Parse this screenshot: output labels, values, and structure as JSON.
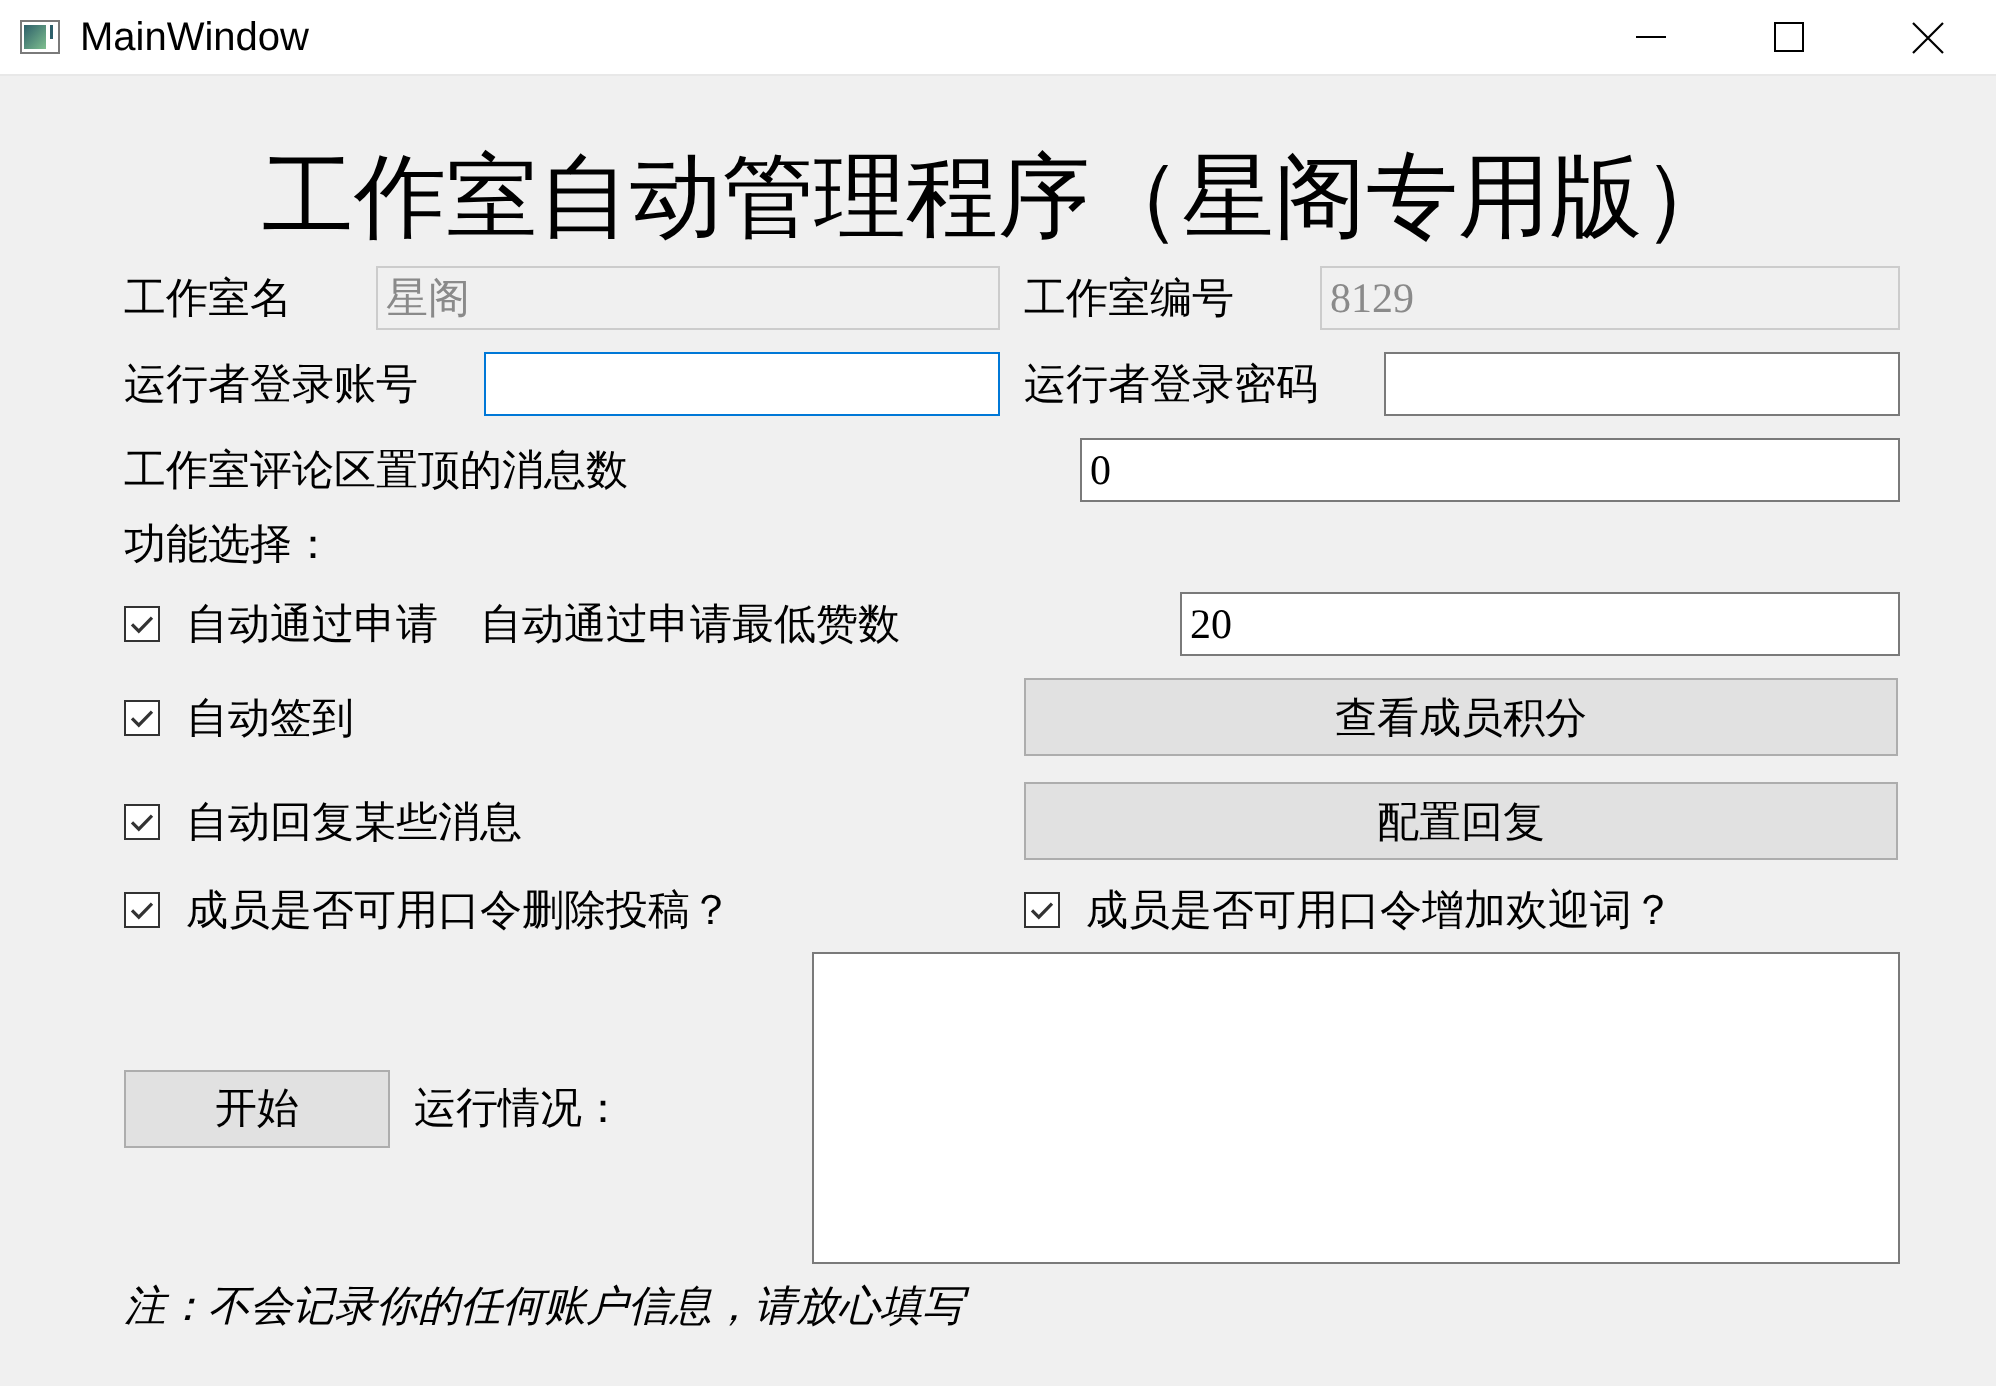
{
  "window": {
    "title": "MainWindow"
  },
  "heading": "工作室自动管理程序（星阁专用版）",
  "studio_name": {
    "label": "工作室名",
    "field": {
      "value": "星阁",
      "disabled": true,
      "focused": false
    }
  },
  "studio_number": {
    "label": "工作室编号",
    "field": {
      "value": "8129",
      "disabled": true,
      "focused": false
    }
  },
  "login_account": {
    "label": "运行者登录账号",
    "field": {
      "disabled": false,
      "focused": true
    }
  },
  "login_password": {
    "label": "运行者登录密码",
    "field": {
      "disabled": false,
      "focused": false
    }
  },
  "pinned_messages": {
    "label": "工作室评论区置顶的消息数",
    "field": {
      "value": "0",
      "disabled": false,
      "focused": false
    }
  },
  "features": {
    "label": "功能选择：",
    "auto_approve": {
      "label": "自动通过申请",
      "checked": true
    },
    "min_likes": {
      "label": "自动通过申请最低赞数",
      "field": {
        "value": "20",
        "disabled": false,
        "focused": false
      }
    },
    "auto_sign_in": {
      "label": "自动签到",
      "checked": true
    },
    "view_points_button": "查看成员积分",
    "auto_reply": {
      "label": "自动回复某些消息",
      "checked": true
    },
    "configure_reply_button": "配置回复",
    "allow_delete_posts": {
      "label": "成员是否可用口令删除投稿？",
      "checked": true
    },
    "allow_welcome_words": {
      "label": "成员是否可用口令增加欢迎词？",
      "checked": true
    }
  },
  "start_button": "开始",
  "run_status": {
    "label": "运行情况："
  },
  "note": "注：不会记录你的任何账户信息，请放心填写"
}
